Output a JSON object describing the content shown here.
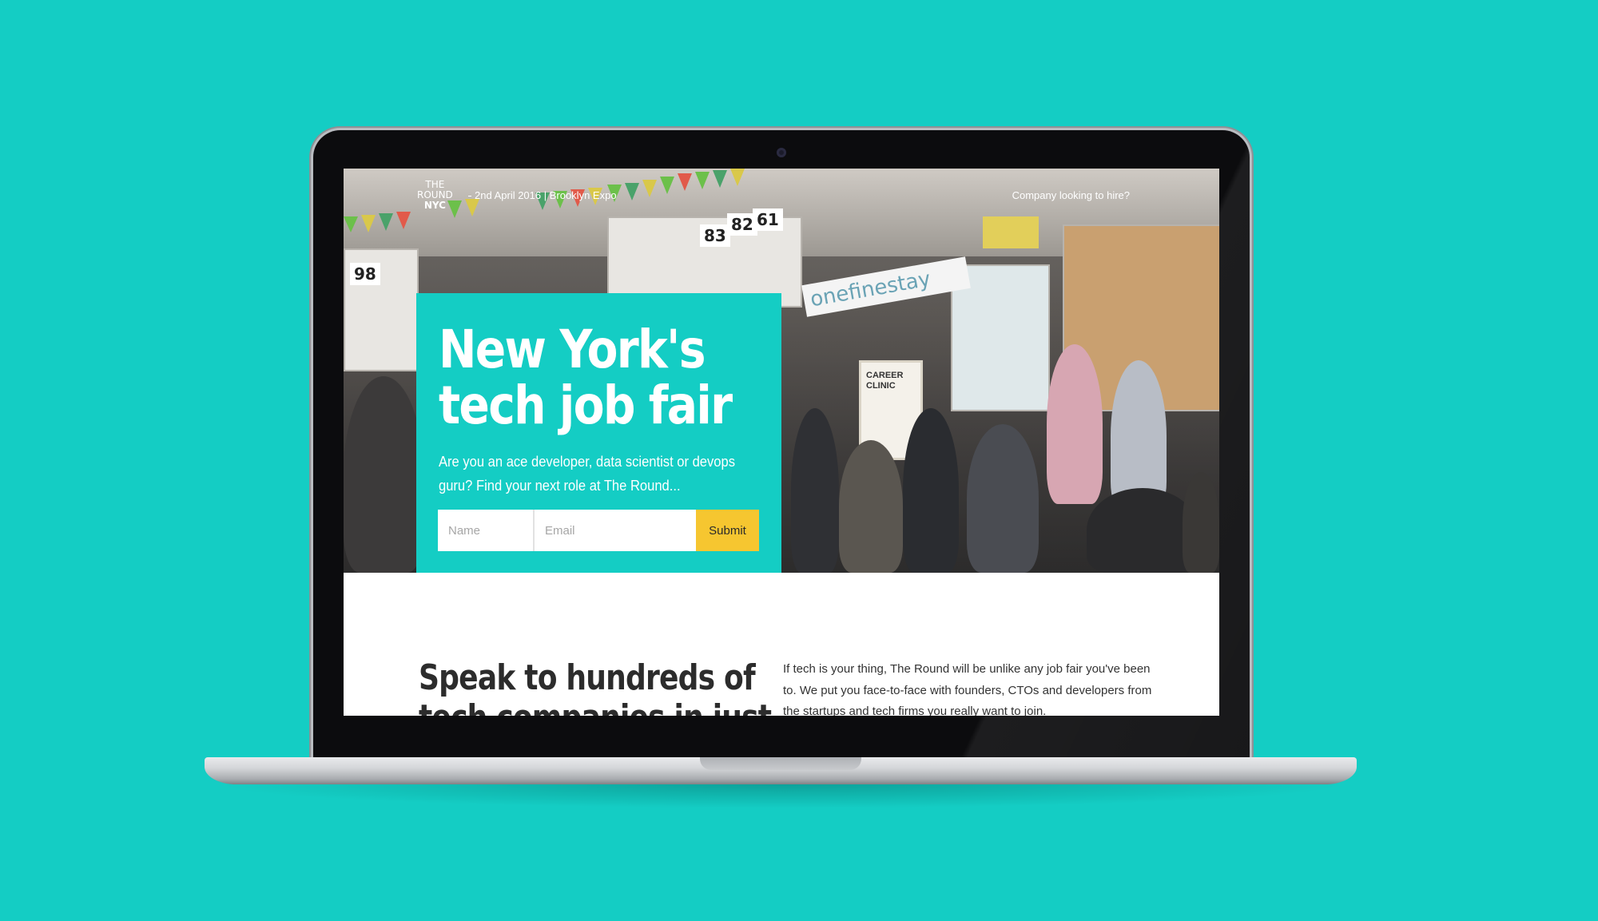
{
  "colors": {
    "brand_teal": "#14cdc4",
    "submit_yellow": "#f6c630"
  },
  "nav": {
    "logo_line1": "THE",
    "logo_line2": "ROUND",
    "logo_line3": "NYC",
    "event_info": "2nd April 2016 | Brooklyn Expo",
    "hire_link": "Company looking to hire?"
  },
  "hero": {
    "title": "New York's tech job fair",
    "subtitle": "Are you an ace developer, data scientist or devops guru? Find your next role at The Round...",
    "form": {
      "name_placeholder": "Name",
      "email_placeholder": "Email",
      "submit_label": "Submit"
    },
    "photo_text": {
      "booth_numbers": [
        "98",
        "83",
        "82",
        "61"
      ],
      "banner": "onefinestay",
      "sign": "CAREER CLINIC"
    }
  },
  "content": {
    "heading": "Speak to hundreds of tech companies in just",
    "body": "If tech is your thing, The Round will be unlike any job fair you've been to. We put you face-to-face with founders, CTOs and developers from the startups and tech firms you really want to join."
  }
}
